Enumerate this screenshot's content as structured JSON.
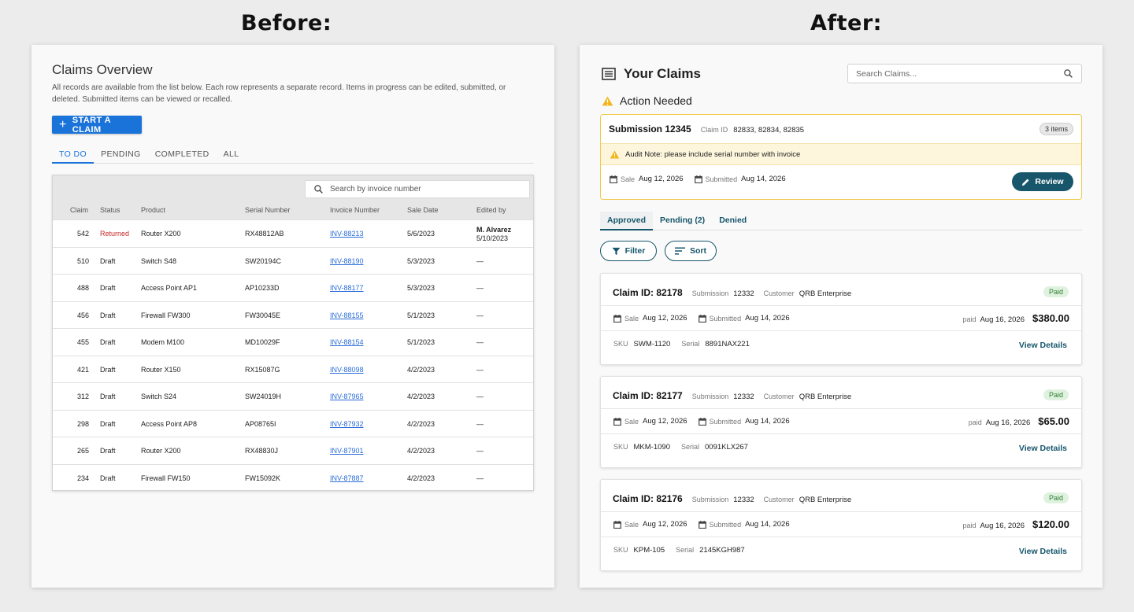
{
  "headings": {
    "before": "Before:",
    "after": "After:"
  },
  "before": {
    "title": "Claims Overview",
    "description": "All records are available from the list below. Each row represents a separate record. Items in progress can be edited, submitted, or deleted. Submitted items can be viewed or recalled.",
    "start_button": "START A CLAIM",
    "tabs": [
      "TO DO",
      "PENDING",
      "COMPLETED",
      "ALL"
    ],
    "active_tab": "TO DO",
    "search_placeholder": "Search by invoice number",
    "columns": [
      "Claim",
      "Status",
      "Product",
      "Serial Number",
      "Invoice Number",
      "Sale Date",
      "Edited by"
    ],
    "rows": [
      {
        "claim": "542",
        "status": "Returned",
        "product": "Router X200",
        "serial": "RX48812AB",
        "invoice": "INV-88213",
        "sale_date": "5/6/2023",
        "edited_by": "M. Alvarez",
        "edited_date": "5/10/2023"
      },
      {
        "claim": "510",
        "status": "Draft",
        "product": "Switch S48",
        "serial": "SW20194C",
        "invoice": "INV-88190",
        "sale_date": "5/3/2023",
        "edited_by": "—"
      },
      {
        "claim": "488",
        "status": "Draft",
        "product": "Access Point AP1",
        "serial": "AP10233D",
        "invoice": "INV-88177",
        "sale_date": "5/3/2023",
        "edited_by": "—"
      },
      {
        "claim": "456",
        "status": "Draft",
        "product": "Firewall FW300",
        "serial": "FW30045E",
        "invoice": "INV-88155",
        "sale_date": "5/1/2023",
        "edited_by": "—"
      },
      {
        "claim": "455",
        "status": "Draft",
        "product": "Modem M100",
        "serial": "MD10029F",
        "invoice": "INV-88154",
        "sale_date": "5/1/2023",
        "edited_by": "—"
      },
      {
        "claim": "421",
        "status": "Draft",
        "product": "Router X150",
        "serial": "RX15087G",
        "invoice": "INV-88098",
        "sale_date": "4/2/2023",
        "edited_by": "—"
      },
      {
        "claim": "312",
        "status": "Draft",
        "product": "Switch S24",
        "serial": "SW24019H",
        "invoice": "INV-87965",
        "sale_date": "4/2/2023",
        "edited_by": "—"
      },
      {
        "claim": "298",
        "status": "Draft",
        "product": "Access Point AP8",
        "serial": "AP08765I",
        "invoice": "INV-87932",
        "sale_date": "4/2/2023",
        "edited_by": "—"
      },
      {
        "claim": "265",
        "status": "Draft",
        "product": "Router X200",
        "serial": "RX48830J",
        "invoice": "INV-87901",
        "sale_date": "4/2/2023",
        "edited_by": "—"
      },
      {
        "claim": "234",
        "status": "Draft",
        "product": "Firewall FW150",
        "serial": "FW15092K",
        "invoice": "INV-87887",
        "sale_date": "4/2/2023",
        "edited_by": "—"
      }
    ]
  },
  "after": {
    "title": "Your Claims",
    "search_placeholder": "Search Claims...",
    "action_needed": "Action Needed",
    "action_card": {
      "submission": "Submission 12345",
      "claim_id_label": "Claim ID",
      "claim_ids": "82833, 82834, 82835",
      "items_count": "3 items",
      "audit_note": "Audit Note: please include serial number with invoice",
      "sale_label": "Sale",
      "sale_date": "Aug 12, 2026",
      "submitted_label": "Submitted",
      "submitted_date": "Aug 14, 2026",
      "review_label": "Review"
    },
    "tabs": [
      "Approved",
      "Pending (2)",
      "Denied"
    ],
    "active_tab": "Approved",
    "filter_label": "Filter",
    "sort_label": "Sort",
    "labels": {
      "submission": "Submission",
      "customer": "Customer",
      "sale": "Sale",
      "submitted": "Submitted",
      "paid": "paid",
      "sku": "SKU",
      "serial": "Serial",
      "view_details": "View Details"
    },
    "claims": [
      {
        "claim_id": "Claim ID: 82178",
        "submission": "12332",
        "customer": "QRB Enterprise",
        "status": "Paid",
        "sale_date": "Aug 12, 2026",
        "submitted_date": "Aug 14, 2026",
        "paid_date": "Aug 16, 2026",
        "amount": "$380.00",
        "sku": "SWM-1120",
        "serial": "8891NAX221"
      },
      {
        "claim_id": "Claim ID: 82177",
        "submission": "12332",
        "customer": "QRB Enterprise",
        "status": "Paid",
        "sale_date": "Aug 12, 2026",
        "submitted_date": "Aug 14, 2026",
        "paid_date": "Aug 16, 2026",
        "amount": "$65.00",
        "sku": "MKM-1090",
        "serial": "0091KLX267"
      },
      {
        "claim_id": "Claim ID: 82176",
        "submission": "12332",
        "customer": "QRB Enterprise",
        "status": "Paid",
        "sale_date": "Aug 12, 2026",
        "submitted_date": "Aug 14, 2026",
        "paid_date": "Aug 16, 2026",
        "amount": "$120.00",
        "sku": "KPM-105",
        "serial": "2145KGH987"
      }
    ]
  },
  "colors": {
    "before_accent": "#1a73d9",
    "after_accent": "#17566b",
    "returned": "#c62828",
    "warning": "#f2c94c",
    "paid_bg": "#dff2df",
    "paid_text": "#2e7d32"
  }
}
